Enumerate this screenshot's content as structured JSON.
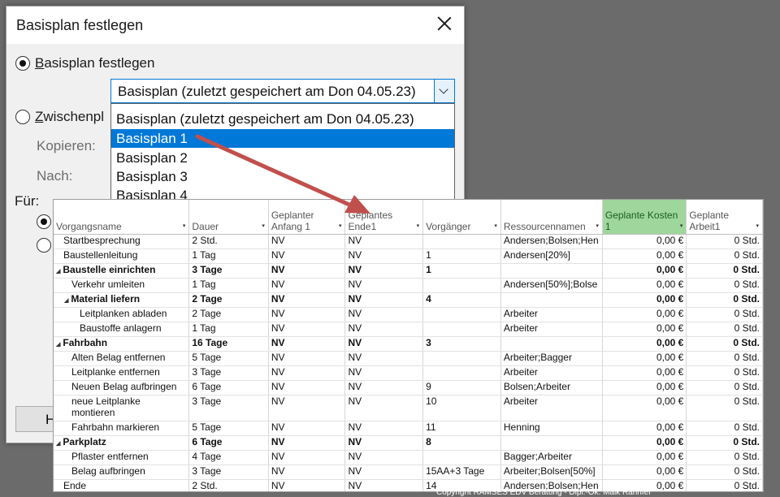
{
  "dialog": {
    "title": "Basisplan festlegen",
    "radio_basisplan": "asisplan festlegen",
    "radio_basisplan_key": "B",
    "selected_baseline": "Basisplan (zuletzt gespeichert am Don 04.05.23)",
    "radio_zwischenplan": "wischenpl",
    "radio_zwischenplan_key": "Z",
    "kopieren_label": "Kopieren:",
    "nach_label": "Nach:",
    "fuer_label": "Für:",
    "button_label": "H"
  },
  "dropdown_items": [
    "Basisplan (zuletzt gespeichert am Don 04.05.23)",
    "Basisplan 1",
    "Basisplan 2",
    "Basisplan 3",
    "Basisplan 4"
  ],
  "dropdown_selected_index": 1,
  "table": {
    "headers": [
      "Vorgangsname",
      "Dauer",
      "Geplanter Anfang 1",
      "Geplantes Ende1",
      "Vorgänger",
      "Ressourcennamen",
      "Geplante Kosten 1",
      "Geplante Arbeit1"
    ],
    "rows": [
      {
        "name": "Startbesprechung",
        "indent": 0,
        "summary": false,
        "dauer": "2 Std.",
        "anfang": "NV",
        "ende": "NV",
        "vorg": "",
        "ress": "Andersen;Bolsen;Hen",
        "kosten": "0,00 €",
        "arbeit": "0 Std."
      },
      {
        "name": "Baustellenleitung",
        "indent": 0,
        "summary": false,
        "dauer": "1 Tag",
        "anfang": "NV",
        "ende": "NV",
        "vorg": "1",
        "ress": "Andersen[20%]",
        "kosten": "0,00 €",
        "arbeit": "0 Std."
      },
      {
        "name": "Baustelle einrichten",
        "indent": 0,
        "summary": true,
        "dauer": "3 Tage",
        "anfang": "NV",
        "ende": "NV",
        "vorg": "1",
        "ress": "",
        "kosten": "0,00 €",
        "arbeit": "0 Std."
      },
      {
        "name": "Verkehr umleiten",
        "indent": 1,
        "summary": false,
        "dauer": "1 Tag",
        "anfang": "NV",
        "ende": "NV",
        "vorg": "",
        "ress": "Andersen[50%];Bolse",
        "kosten": "0,00 €",
        "arbeit": "0 Std."
      },
      {
        "name": "Material liefern",
        "indent": 1,
        "summary": true,
        "dauer": "2 Tage",
        "anfang": "NV",
        "ende": "NV",
        "vorg": "4",
        "ress": "",
        "kosten": "0,00 €",
        "arbeit": "0 Std."
      },
      {
        "name": "Leitplanken abladen",
        "indent": 2,
        "summary": false,
        "dauer": "2 Tage",
        "anfang": "NV",
        "ende": "NV",
        "vorg": "",
        "ress": "Arbeiter",
        "kosten": "0,00 €",
        "arbeit": "0 Std."
      },
      {
        "name": "Baustoffe anlagern",
        "indent": 2,
        "summary": false,
        "dauer": "1 Tag",
        "anfang": "NV",
        "ende": "NV",
        "vorg": "",
        "ress": "Arbeiter",
        "kosten": "0,00 €",
        "arbeit": "0 Std."
      },
      {
        "name": "Fahrbahn",
        "indent": 0,
        "summary": true,
        "dauer": "16 Tage",
        "anfang": "NV",
        "ende": "NV",
        "vorg": "3",
        "ress": "",
        "kosten": "0,00 €",
        "arbeit": "0 Std."
      },
      {
        "name": "Alten Belag entfernen",
        "indent": 1,
        "summary": false,
        "dauer": "5 Tage",
        "anfang": "NV",
        "ende": "NV",
        "vorg": "",
        "ress": "Arbeiter;Bagger",
        "kosten": "0,00 €",
        "arbeit": "0 Std."
      },
      {
        "name": "Leitplanke entfernen",
        "indent": 1,
        "summary": false,
        "dauer": "3 Tage",
        "anfang": "NV",
        "ende": "NV",
        "vorg": "",
        "ress": "Arbeiter",
        "kosten": "0,00 €",
        "arbeit": "0 Std."
      },
      {
        "name": "Neuen Belag aufbringen",
        "indent": 1,
        "summary": false,
        "dauer": "6 Tage",
        "anfang": "NV",
        "ende": "NV",
        "vorg": "9",
        "ress": "Bolsen;Arbeiter",
        "kosten": "0,00 €",
        "arbeit": "0 Std."
      },
      {
        "name": "neue Leitplanke montieren",
        "indent": 1,
        "summary": false,
        "tall": true,
        "dauer": "3 Tage",
        "anfang": "NV",
        "ende": "NV",
        "vorg": "10",
        "ress": "Arbeiter",
        "kosten": "0,00 €",
        "arbeit": "0 Std."
      },
      {
        "name": "Fahrbahn markieren",
        "indent": 1,
        "summary": false,
        "dauer": "5 Tage",
        "anfang": "NV",
        "ende": "NV",
        "vorg": "11",
        "ress": "Henning",
        "kosten": "0,00 €",
        "arbeit": "0 Std."
      },
      {
        "name": "Parkplatz",
        "indent": 0,
        "summary": true,
        "dauer": "6 Tage",
        "anfang": "NV",
        "ende": "NV",
        "vorg": "8",
        "ress": "",
        "kosten": "0,00 €",
        "arbeit": "0 Std."
      },
      {
        "name": "Pflaster entfernen",
        "indent": 1,
        "summary": false,
        "dauer": "4 Tage",
        "anfang": "NV",
        "ende": "NV",
        "vorg": "",
        "ress": "Bagger;Arbeiter",
        "kosten": "0,00 €",
        "arbeit": "0 Std."
      },
      {
        "name": "Belag aufbringen",
        "indent": 1,
        "summary": false,
        "dauer": "3 Tage",
        "anfang": "NV",
        "ende": "NV",
        "vorg": "15AA+3 Tage",
        "ress": "Arbeiter;Bolsen[50%]",
        "kosten": "0,00 €",
        "arbeit": "0 Std."
      },
      {
        "name": "Ende",
        "indent": 0,
        "summary": false,
        "dauer": "2 Std.",
        "anfang": "NV",
        "ende": "NV",
        "vorg": "14",
        "ress": "Andersen;Bolsen;Hen",
        "kosten": "0,00 €",
        "arbeit": "0 Std."
      }
    ]
  },
  "copyright": "Copyright RAMSES EDV Beratung - Dipl.-Ök. Maik Rahnfel",
  "colors": {
    "highlight_header": "#9fd69c",
    "selection": "#0078d7",
    "arrow": "#c0504d"
  }
}
